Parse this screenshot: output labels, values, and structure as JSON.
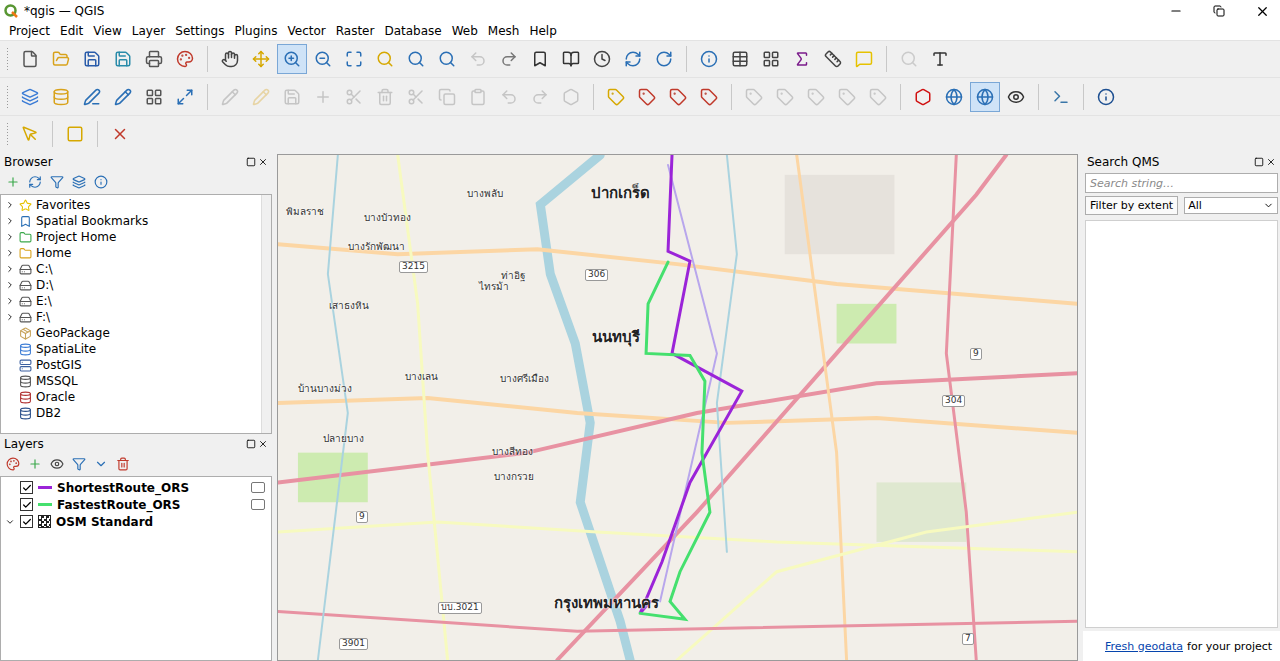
{
  "window": {
    "title": "*qgis — QGIS"
  },
  "menu": [
    "Project",
    "Edit",
    "View",
    "Layer",
    "Settings",
    "Plugins",
    "Vector",
    "Raster",
    "Database",
    "Web",
    "Mesh",
    "Help"
  ],
  "toolbars": [
    {
      "items": [
        {
          "selected": false,
          "disabled": false
        },
        {
          "selected": false,
          "disabled": false
        },
        {
          "selected": false,
          "disabled": false
        },
        {
          "selected": false,
          "disabled": false
        },
        {
          "selected": false,
          "disabled": false
        },
        {
          "selected": false,
          "disabled": false
        },
        {
          "selected": false,
          "disabled": false
        },
        {
          "selected": false,
          "disabled": false
        },
        {
          "selected": true,
          "disabled": false
        },
        {
          "selected": false,
          "disabled": false
        },
        {
          "selected": false,
          "disabled": false
        },
        {
          "selected": false,
          "disabled": false
        },
        {
          "selected": false,
          "disabled": false
        },
        {
          "selected": false,
          "disabled": false
        },
        {
          "selected": false,
          "disabled": true
        },
        {
          "selected": false,
          "disabled": false
        },
        {
          "selected": false,
          "disabled": false
        },
        {
          "selected": false,
          "disabled": false
        },
        {
          "selected": false,
          "disabled": false
        },
        {
          "selected": false,
          "disabled": false
        },
        {
          "selected": false,
          "disabled": false
        },
        {
          "selected": false,
          "disabled": false
        },
        {
          "selected": false,
          "disabled": false
        },
        {
          "selected": false,
          "disabled": false
        },
        {
          "selected": false,
          "disabled": false
        },
        {
          "selected": false,
          "disabled": false
        },
        {
          "selected": false,
          "disabled": false
        },
        {
          "selected": false,
          "disabled": true
        },
        {
          "selected": false,
          "disabled": false
        }
      ]
    },
    {
      "items": [
        {
          "selected": false,
          "disabled": false
        },
        {
          "selected": false,
          "disabled": false
        },
        {
          "selected": false,
          "disabled": false
        },
        {
          "selected": false,
          "disabled": false
        },
        {
          "selected": false,
          "disabled": false
        },
        {
          "selected": false,
          "disabled": false
        },
        {
          "selected": false,
          "disabled": true
        },
        {
          "selected": false,
          "disabled": true
        },
        {
          "selected": false,
          "disabled": true
        },
        {
          "selected": false,
          "disabled": true
        },
        {
          "selected": false,
          "disabled": true
        },
        {
          "selected": false,
          "disabled": true
        },
        {
          "selected": false,
          "disabled": true
        },
        {
          "selected": false,
          "disabled": true
        },
        {
          "selected": false,
          "disabled": true
        },
        {
          "selected": false,
          "disabled": true
        },
        {
          "selected": false,
          "disabled": true
        },
        {
          "selected": false,
          "disabled": true
        },
        {
          "selected": false,
          "disabled": false
        },
        {
          "selected": false,
          "disabled": false
        },
        {
          "selected": false,
          "disabled": false
        },
        {
          "selected": false,
          "disabled": false
        },
        {
          "selected": false,
          "disabled": true
        },
        {
          "selected": false,
          "disabled": true
        },
        {
          "selected": false,
          "disabled": true
        },
        {
          "selected": false,
          "disabled": true
        },
        {
          "selected": false,
          "disabled": true
        },
        {
          "selected": false,
          "disabled": false
        },
        {
          "selected": false,
          "disabled": false
        },
        {
          "selected": true,
          "disabled": false
        },
        {
          "selected": false,
          "disabled": false
        },
        {
          "selected": false,
          "disabled": false
        },
        {
          "selected": false,
          "disabled": false
        }
      ]
    },
    {
      "items": [
        {
          "selected": false,
          "disabled": false
        },
        {
          "selected": false,
          "disabled": false
        },
        {
          "selected": false,
          "disabled": false
        }
      ]
    }
  ],
  "browser": {
    "title": "Browser",
    "items": [
      {
        "label": "Favorites",
        "expandable": true
      },
      {
        "label": "Spatial Bookmarks",
        "expandable": true
      },
      {
        "label": "Project Home",
        "expandable": true
      },
      {
        "label": "Home",
        "expandable": true
      },
      {
        "label": "C:\\",
        "expandable": true
      },
      {
        "label": "D:\\",
        "expandable": true
      },
      {
        "label": "E:\\",
        "expandable": true
      },
      {
        "label": "F:\\",
        "expandable": true
      },
      {
        "label": "GeoPackage",
        "expandable": false
      },
      {
        "label": "SpatiaLite",
        "expandable": false
      },
      {
        "label": "PostGIS",
        "expandable": false
      },
      {
        "label": "MSSQL",
        "expandable": false
      },
      {
        "label": "Oracle",
        "expandable": false
      },
      {
        "label": "DB2",
        "expandable": false
      }
    ]
  },
  "layers": {
    "title": "Layers",
    "items": [
      {
        "name": "ShortestRoute_ORS",
        "checked": true,
        "kind": "line",
        "color": "#9b24d8",
        "expanded": false
      },
      {
        "name": "FastestRoute_ORS",
        "checked": true,
        "kind": "line",
        "color": "#45e06e",
        "expanded": false
      },
      {
        "name": "OSM Standard",
        "checked": true,
        "kind": "raster",
        "color": "#333333",
        "expanded": true
      }
    ]
  },
  "map": {
    "labels": [
      {
        "text": "ปากเกร็ด",
        "kind": "city"
      },
      {
        "text": "นนทบุรี",
        "kind": "city"
      },
      {
        "text": "กรุงเทพมหานคร",
        "kind": "city"
      },
      {
        "text": "บางพลับ",
        "kind": "place"
      },
      {
        "text": "บางบัวทอง",
        "kind": "place"
      },
      {
        "text": "บางรักพัฒนา",
        "kind": "place"
      },
      {
        "text": "พิมลราช",
        "kind": "place"
      },
      {
        "text": "ไทรม้า",
        "kind": "place"
      },
      {
        "text": "เสาธงหิน",
        "kind": "place"
      },
      {
        "text": "บางเลน",
        "kind": "place"
      },
      {
        "text": "บางกรวย",
        "kind": "place"
      },
      {
        "text": "บางสีทอง",
        "kind": "place"
      },
      {
        "text": "บ้านบางม่วง",
        "kind": "place"
      },
      {
        "text": "ปลายบาง",
        "kind": "place"
      },
      {
        "text": "บางศรีเมือง",
        "kind": "place"
      },
      {
        "text": "ท่าอิฐ",
        "kind": "place"
      },
      {
        "text": "3215",
        "kind": "shield"
      },
      {
        "text": "306",
        "kind": "shield"
      },
      {
        "text": "304",
        "kind": "shield"
      },
      {
        "text": "9",
        "kind": "shield"
      },
      {
        "text": "3901",
        "kind": "shield"
      },
      {
        "text": "บบ.3021",
        "kind": "shield"
      },
      {
        "text": "9",
        "kind": "shield"
      },
      {
        "text": "7",
        "kind": "shield"
      }
    ]
  },
  "search_qms": {
    "title": "Search QMS",
    "placeholder": "Search string…",
    "filter_button": "Filter by extent",
    "filter_select": "All",
    "footer_link": "Fresh geodata",
    "footer_text": "for your project"
  }
}
